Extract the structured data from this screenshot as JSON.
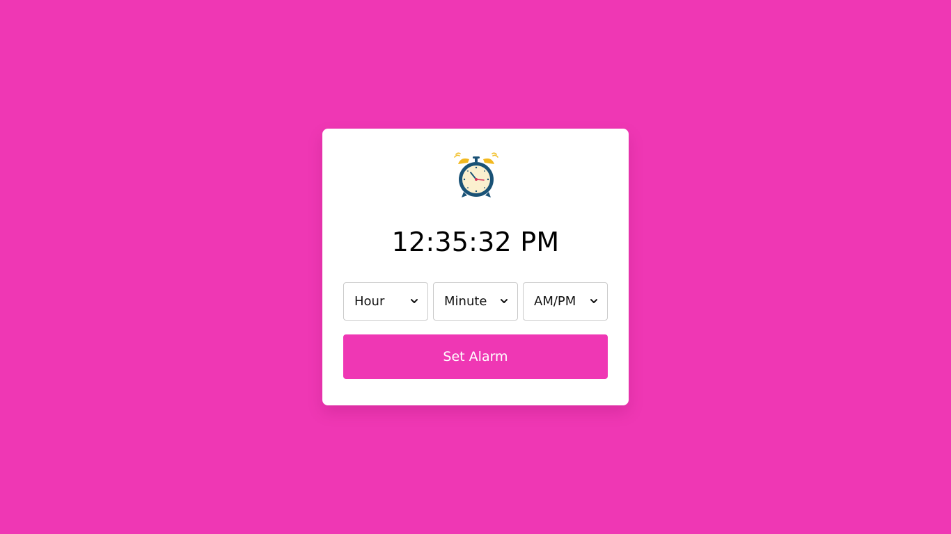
{
  "clock": {
    "icon": "alarm-clock-icon",
    "time": "12:35:32 PM"
  },
  "selectors": {
    "hour": "Hour",
    "minute": "Minute",
    "ampm": "AM/PM"
  },
  "actions": {
    "set_alarm_label": "Set Alarm"
  },
  "colors": {
    "background": "#ef37b4",
    "card": "#ffffff",
    "button": "#ef37b4",
    "button_text": "#ffffff",
    "time_text": "#000000"
  }
}
